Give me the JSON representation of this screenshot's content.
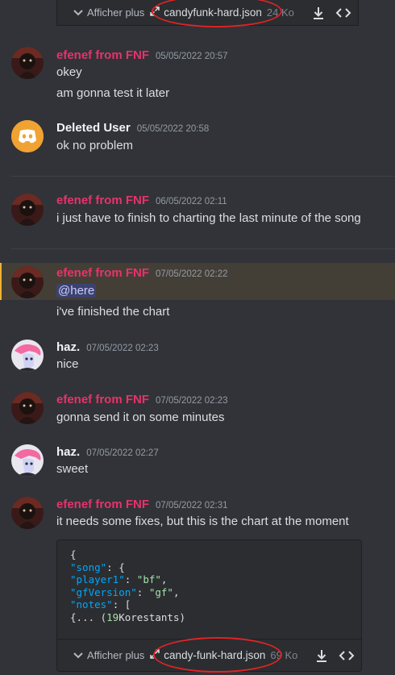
{
  "attachment_top": {
    "expand_label": "Afficher plus",
    "filename": "candyfunk-hard.json",
    "size": "24 Ko"
  },
  "messages": [
    {
      "user": "efenef from FNF",
      "time": "05/05/2022 20:57",
      "lines": [
        "okey",
        "am gonna test it later"
      ]
    },
    {
      "user": "Deleted User",
      "time": "05/05/2022 20:58",
      "lines": [
        "ok no problem"
      ]
    },
    {
      "user": "efenef from FNF",
      "time": "06/05/2022 02:11",
      "lines": [
        "i just have to finish to charting the last minute of the song"
      ]
    },
    {
      "user": "efenef from FNF",
      "time": "07/05/2022 02:22",
      "mention": "@here",
      "lines": [
        "i've finished the chart"
      ]
    },
    {
      "user": "haz.",
      "time": "07/05/2022 02:23",
      "lines": [
        "nice"
      ]
    },
    {
      "user": "efenef from FNF",
      "time": "07/05/2022 02:23",
      "lines": [
        "gonna send it on some minutes"
      ]
    },
    {
      "user": "haz.",
      "time": "07/05/2022 02:27",
      "lines": [
        "sweet"
      ]
    },
    {
      "user": "efenef from FNF",
      "time": "07/05/2022 02:31",
      "lines": [
        "it needs some fixes, but this is the chart at the moment"
      ]
    }
  ],
  "code_preview": {
    "l1": "{",
    "l2_key": "\"song\"",
    "l2_rest": ": {",
    "l3_key": "\"player1\"",
    "l3_mid": ": ",
    "l3_val": "\"bf\"",
    "l3_end": ",",
    "l4_key": "\"gfVersion\"",
    "l4_mid": ": ",
    "l4_val": "\"gf\"",
    "l4_end": ",",
    "l5_key": "\"notes\"",
    "l5_rest": ": [",
    "l6_a": "{... (",
    "l6_b": "19",
    "l6_c": "Korestants)"
  },
  "attachment_bottom": {
    "expand_label": "Afficher plus",
    "filename": "candy-funk-hard.json",
    "size": "69 Ko"
  },
  "colors": {
    "background": "#313338",
    "username_accent": "#e8336a",
    "annotation": "#e02424",
    "mention_highlight": "#433f37"
  }
}
